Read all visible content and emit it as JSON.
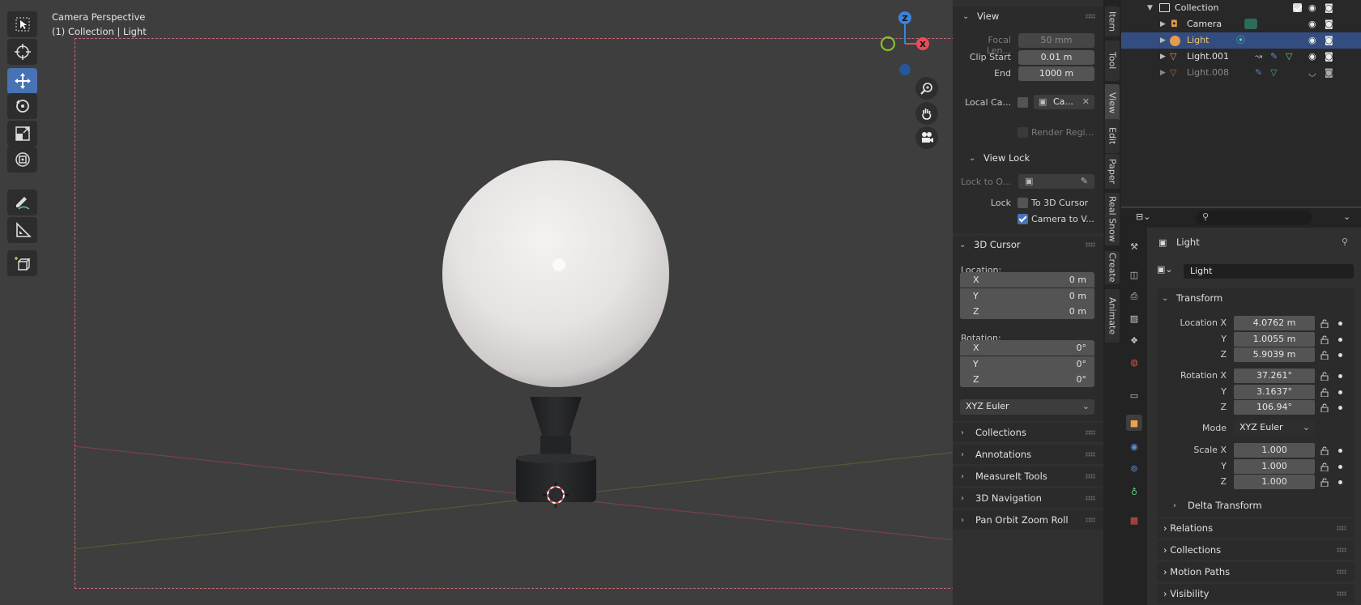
{
  "viewport": {
    "title": "Camera Perspective",
    "subtitle": "(1) Collection | Light"
  },
  "toolbar": {
    "tools": [
      {
        "name": "select-tool",
        "active": false
      },
      {
        "name": "cursor-tool",
        "active": false
      },
      {
        "name": "move-tool",
        "active": true
      },
      {
        "name": "rotate-tool",
        "active": false
      },
      {
        "name": "scale-tool",
        "active": false
      },
      {
        "name": "transform-tool",
        "active": false
      },
      {
        "name": "annotate-tool",
        "active": false
      },
      {
        "name": "measure-tool",
        "active": false
      },
      {
        "name": "add-cube-tool",
        "active": false
      }
    ]
  },
  "gizmo": {
    "z": "Z",
    "x": "X"
  },
  "npanel": {
    "view": {
      "header": "View",
      "focal_label": "Focal Len...",
      "focal_value": "50 mm",
      "clip_start_label": "Clip Start",
      "clip_start_value": "0.01 m",
      "end_label": "End",
      "end_value": "1000 m",
      "local_camera_label": "Local Ca...",
      "local_camera_value": "Ca...",
      "render_region_label": "Render Regi..."
    },
    "view_lock": {
      "header": "View Lock",
      "lock_to_label": "Lock to O...",
      "lock_label": "Lock",
      "to_3d_cursor": "To 3D Cursor",
      "camera_to_view": "Camera to V...",
      "camera_to_view_checked": true
    },
    "cursor": {
      "header": "3D Cursor",
      "location_label": "Location:",
      "location": [
        {
          "k": "X",
          "v": "0 m"
        },
        {
          "k": "Y",
          "v": "0 m"
        },
        {
          "k": "Z",
          "v": "0 m"
        }
      ],
      "rotation_label": "Rotation:",
      "rotation": [
        {
          "k": "X",
          "v": "0°"
        },
        {
          "k": "Y",
          "v": "0°"
        },
        {
          "k": "Z",
          "v": "0°"
        }
      ],
      "mode": "XYZ Euler"
    },
    "collapsed": [
      "Collections",
      "Annotations",
      "MeasureIt Tools",
      "3D Navigation",
      "Pan Orbit Zoom Roll"
    ]
  },
  "side_tabs": [
    "Item",
    "Tool",
    "View",
    "Edit",
    "Paper",
    "Real Snow",
    "Create",
    "Animate"
  ],
  "outliner": {
    "rows": [
      {
        "label": "Collection"
      },
      {
        "label": "Camera"
      },
      {
        "label": "Light"
      },
      {
        "label": "Light.001"
      },
      {
        "label": "Light.008"
      }
    ]
  },
  "properties": {
    "object_name": "Light",
    "data_name": "Light",
    "transform_header": "Transform",
    "location_label": "Location X",
    "location": [
      "4.0762 m",
      "1.0055 m",
      "5.9039 m"
    ],
    "rotation_label": "Rotation X",
    "rotation": [
      "37.261°",
      "3.1637°",
      "106.94°"
    ],
    "mode_label": "Mode",
    "mode": "XYZ Euler",
    "scale_label": "Scale X",
    "scale": [
      "1.000",
      "1.000",
      "1.000"
    ],
    "axis_y": "Y",
    "axis_z": "Z",
    "delta_transform": "Delta Transform",
    "sections": [
      "Relations",
      "Collections",
      "Motion Paths",
      "Visibility"
    ]
  },
  "colors": {
    "accent": "#4772b3",
    "selection": "#334d80",
    "axis_x": "#e44d5d",
    "axis_y": "#8bbd2b",
    "axis_z": "#3a83d9",
    "light_orange": "#e39c4b"
  }
}
